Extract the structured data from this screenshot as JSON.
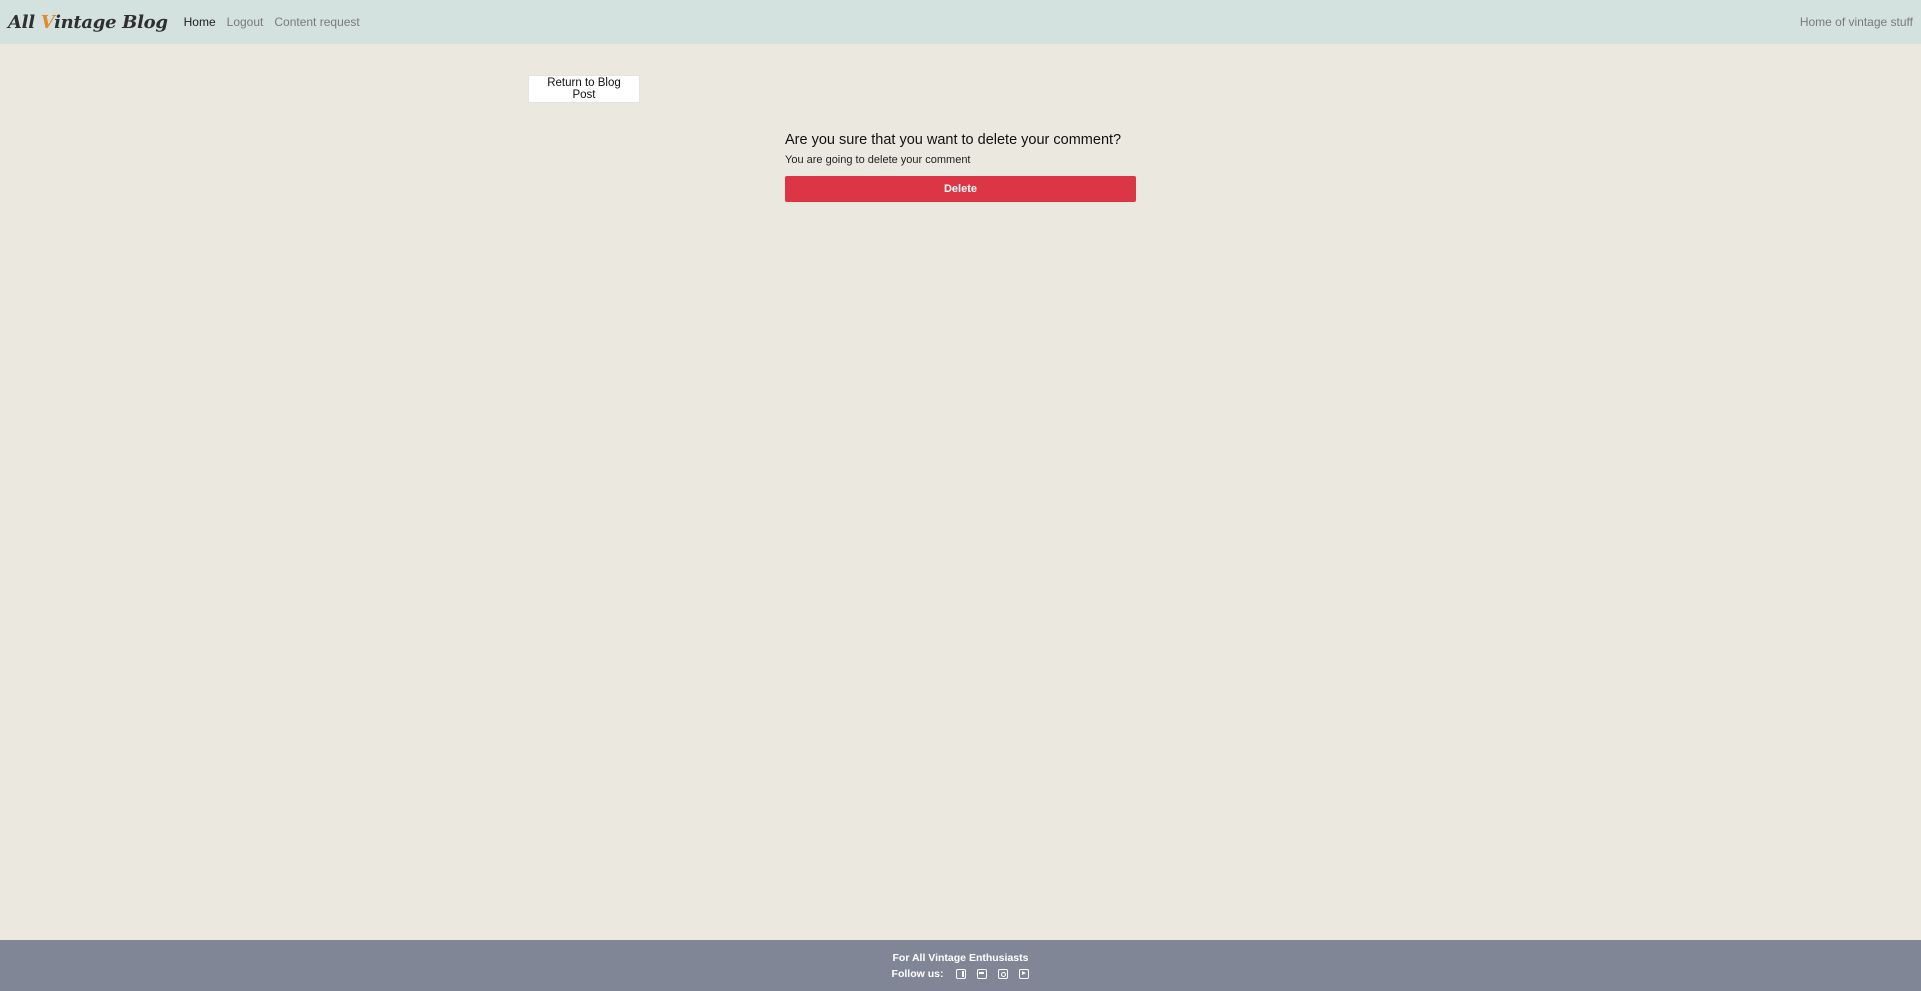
{
  "navbar": {
    "brand_part1": "All ",
    "brand_accent": "V",
    "brand_part2": "intage Blog",
    "links": [
      {
        "label": "Home",
        "active": true
      },
      {
        "label": "Logout",
        "active": false
      },
      {
        "label": "Content request",
        "active": false
      }
    ],
    "tagline": "Home of vintage stuff"
  },
  "main": {
    "return_button": "Return to Blog Post",
    "confirm_title": "Are you sure that you want to delete your comment?",
    "confirm_text": "You are going to delete your comment",
    "delete_button": "Delete"
  },
  "footer": {
    "tagline": "For All Vintage Enthusiasts",
    "follow_label": "Follow us:",
    "social": [
      "facebook-icon",
      "twitter-icon",
      "instagram-icon",
      "youtube-icon"
    ]
  },
  "colors": {
    "navbar_bg": "#d3e2df",
    "page_bg": "#ebe8e0",
    "danger": "#dc3545",
    "footer_bg": "#808696",
    "brand_accent": "#e08a2c"
  }
}
